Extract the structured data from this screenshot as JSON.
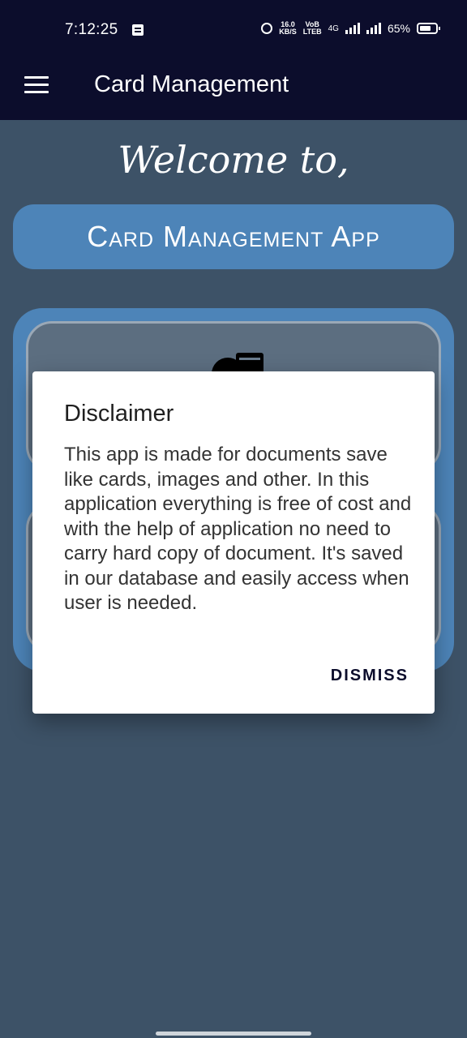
{
  "status_bar": {
    "time": "7:12:25",
    "net_speed_top": "16.0",
    "net_speed_bottom": "KB/S",
    "volte_top": "VoB",
    "volte_bottom": "LTEB",
    "network_label": "4G",
    "battery": "65%"
  },
  "appbar": {
    "title": "Card Management"
  },
  "main": {
    "welcome": "Welcome to,",
    "banner": "Card Management App"
  },
  "dialog": {
    "title": "Disclaimer",
    "body": "This app is made for documents save like cards, images and other. In this application everything is free of cost and with the help of application no need to carry hard copy of document. It's saved in our database and easily access when user is needed.",
    "dismiss_label": "DISMISS"
  },
  "colors": {
    "appbar": "#0c0d2c",
    "background": "#3d5267",
    "accent": "#4d84b8",
    "dialog_button": "#0c0d2c"
  }
}
